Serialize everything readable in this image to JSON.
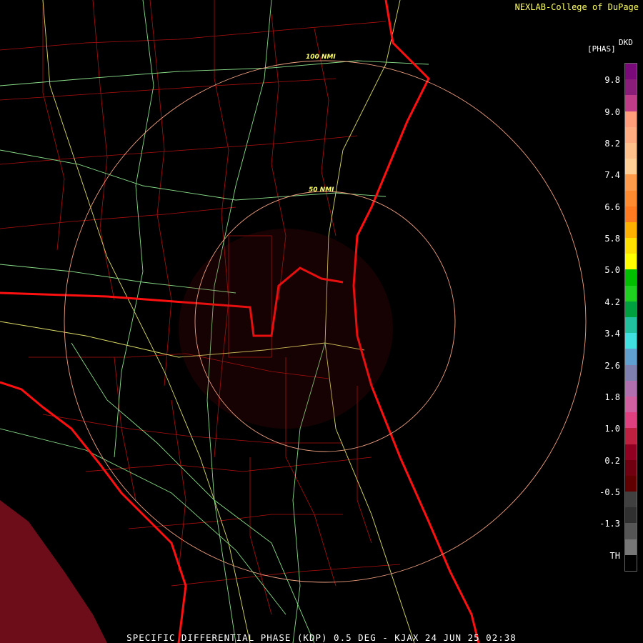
{
  "credit": "NEXLAB-College of DuPage",
  "units_code": "DKD",
  "units_name": "[PHAS]",
  "footer": "SPECIFIC DIFFERENTIAL PHASE (KDP) 0.5 DEG - KJAX 24 JUN 25 02:38",
  "ring_labels": {
    "outer": "100 NMI",
    "inner": "50 NMI"
  },
  "legend_ticks": [
    "9.8",
    "9.0",
    "8.2",
    "7.4",
    "6.6",
    "5.8",
    "5.0",
    "4.2",
    "3.4",
    "2.6",
    "1.8",
    "1.0",
    "0.2",
    "-0.5",
    "-1.3",
    "TH"
  ],
  "colorbar_colors": [
    "#7a0a7a",
    "#8a1c7a",
    "#c13c88",
    "#ff9d7a",
    "#ffad80",
    "#ffc08a",
    "#ffcf95",
    "#ff9b4a",
    "#ff8a30",
    "#ff7a20",
    "#ffb000",
    "#ffe000",
    "#ffff00",
    "#00c000",
    "#20d020",
    "#00a040",
    "#20c0a0",
    "#40e0e0",
    "#60a0d0",
    "#8080b0",
    "#b070b0",
    "#d060a0",
    "#e04080",
    "#c02040",
    "#900020",
    "#700010",
    "#600000",
    "#404040",
    "#303030",
    "#555555",
    "#777777",
    "#000000"
  ]
}
